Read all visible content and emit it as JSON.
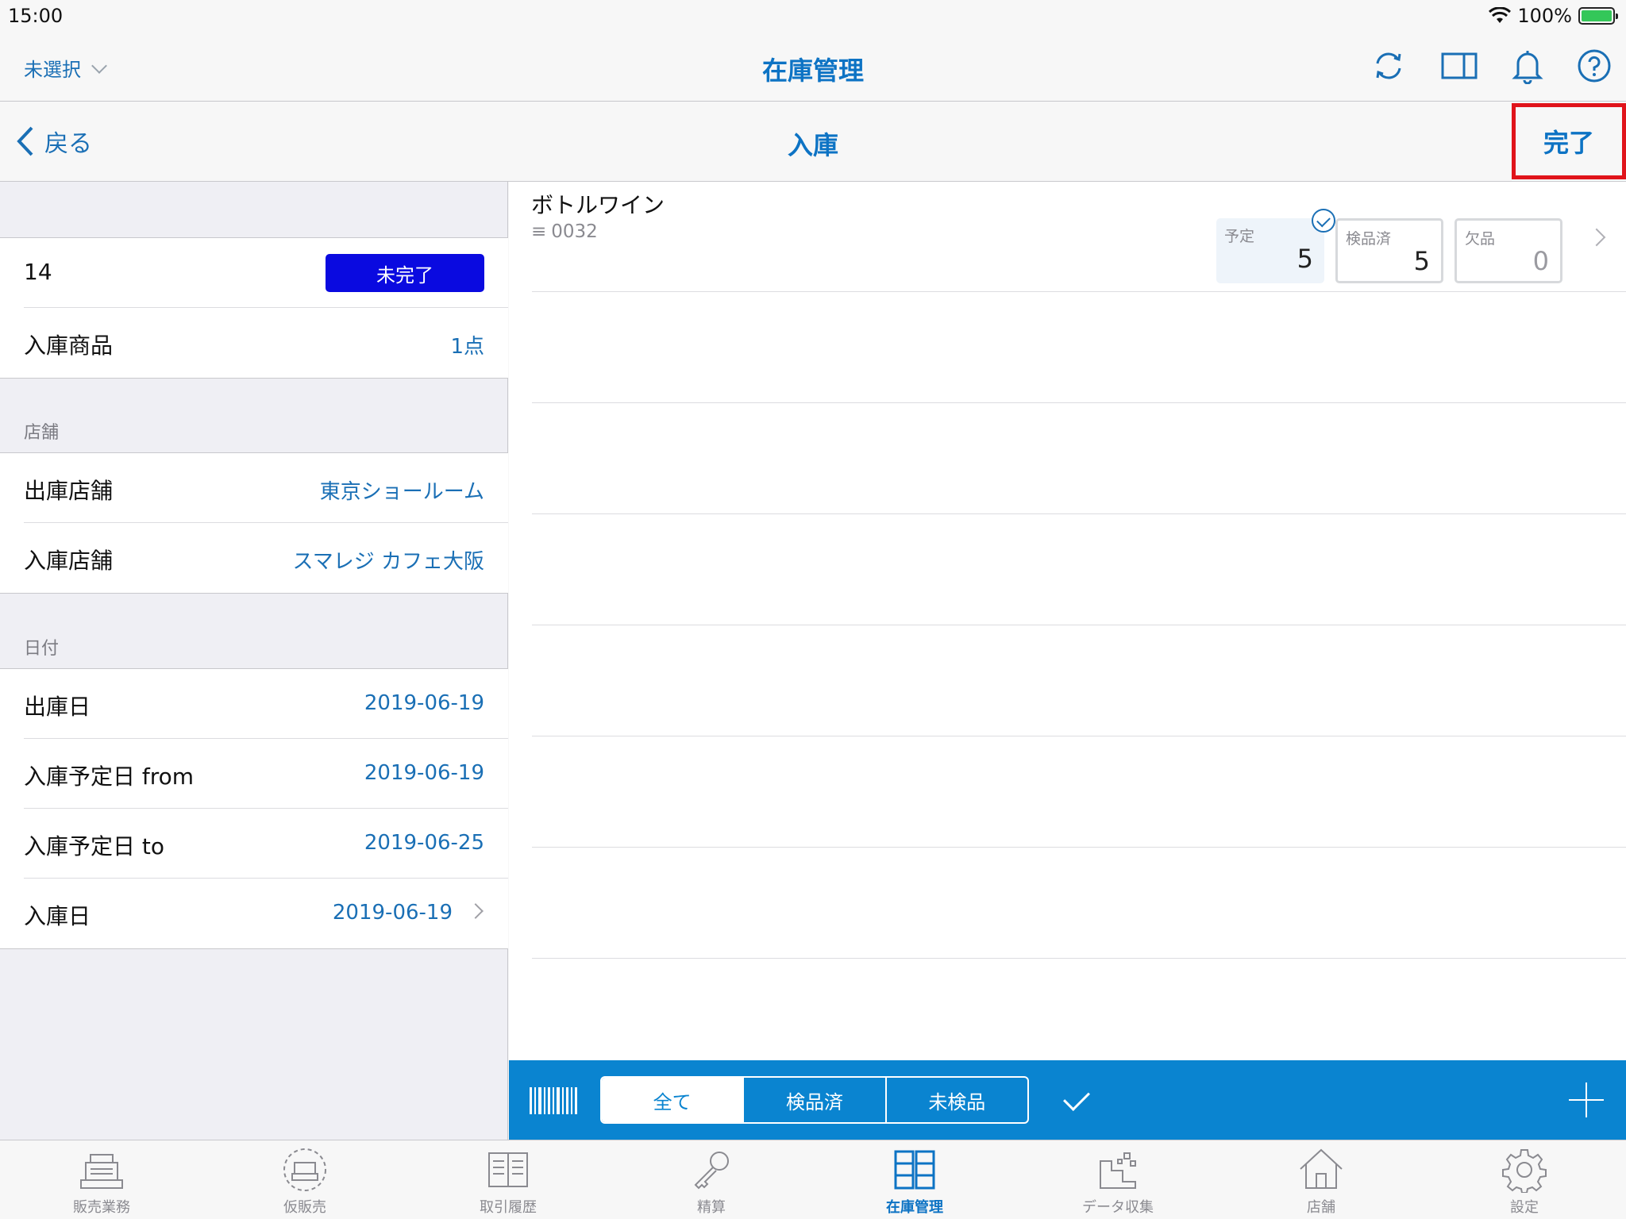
{
  "status_bar": {
    "time": "15:00",
    "battery_pct": "100%"
  },
  "top_nav": {
    "store_select": "未選択",
    "title": "在庫管理"
  },
  "sub_nav": {
    "back_label": "戻る",
    "title": "入庫",
    "done_label": "完了"
  },
  "left": {
    "id_value": "14",
    "status_label": "未完了",
    "product_label": "入庫商品",
    "product_count": "1点",
    "store_section": "店舗",
    "ship_store_label": "出庫店舗",
    "ship_store_value": "東京ショールーム",
    "recv_store_label": "入庫店舗",
    "recv_store_value": "スマレジ カフェ大阪",
    "date_section": "日付",
    "ship_date_label": "出庫日",
    "ship_date_value": "2019-06-19",
    "plan_from_label": "入庫予定日 from",
    "plan_from_value": "2019-06-19",
    "plan_to_label": "入庫予定日 to",
    "plan_to_value": "2019-06-25",
    "recv_date_label": "入庫日",
    "recv_date_value": "2019-06-19"
  },
  "item": {
    "name": "ボトルワイン",
    "code_icon": "≡",
    "code": "0032",
    "plan_label": "予定",
    "plan_value": "5",
    "checked_label": "検品済",
    "checked_value": "5",
    "missing_label": "欠品",
    "missing_value": "0"
  },
  "action_bar": {
    "seg_all": "全て",
    "seg_checked": "検品済",
    "seg_unchecked": "未検品"
  },
  "tabs": [
    {
      "label": "販売業務",
      "icon": "register-icon"
    },
    {
      "label": "仮販売",
      "icon": "temp-register-icon"
    },
    {
      "label": "取引履歴",
      "icon": "book-icon"
    },
    {
      "label": "精算",
      "icon": "key-icon"
    },
    {
      "label": "在庫管理",
      "icon": "cabinet-icon"
    },
    {
      "label": "データ収集",
      "icon": "data-icon"
    },
    {
      "label": "店舗",
      "icon": "house-icon"
    },
    {
      "label": "設定",
      "icon": "gear-icon"
    }
  ],
  "colors": {
    "accent": "#0d73c4",
    "action_bar": "#0a84d0",
    "status_pill": "#0a0ae0",
    "highlight": "#e0141b"
  }
}
